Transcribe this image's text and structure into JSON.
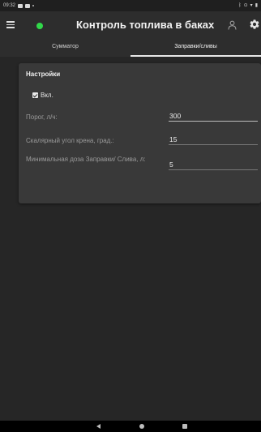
{
  "status_bar": {
    "time": "09:32"
  },
  "app_bar": {
    "title": "Контроль топлива в баках",
    "status_color": "#31d84a"
  },
  "tabs": [
    {
      "label": "Сумматор",
      "active": false
    },
    {
      "label": "Заправки/сливы",
      "active": true
    }
  ],
  "settings": {
    "title": "Настройки",
    "enabled_label": "Вкл.",
    "enabled": true,
    "fields": [
      {
        "label": "Порог, л/ч:",
        "value": "300"
      },
      {
        "label": "Скалярный угол крена, град.:",
        "value": "15"
      },
      {
        "label": "Минимальная доза Заправки/ Слива, л:",
        "value": "5"
      }
    ]
  },
  "icons": {
    "menu": "menu-icon",
    "user": "user-icon",
    "settings": "gear-icon",
    "nav_back": "back-icon",
    "nav_home": "home-icon",
    "nav_recents": "recents-icon"
  }
}
